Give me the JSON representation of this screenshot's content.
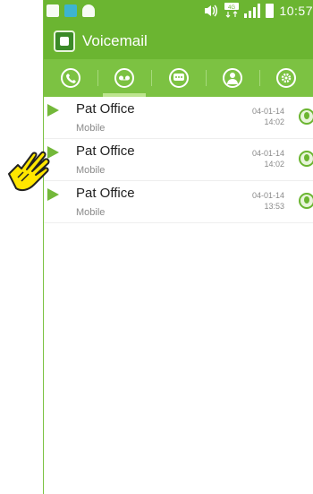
{
  "status_bar": {
    "time": "10:57",
    "network_label": "4G",
    "icons": [
      "gallery-icon",
      "app-icon",
      "chat-icon",
      "volume-icon",
      "network-icon",
      "signal-icon",
      "battery-icon"
    ]
  },
  "header": {
    "title": "Voicemail",
    "logo_icon": "voicemail-app-icon"
  },
  "tabs": [
    {
      "icon": "phone-icon",
      "active": false
    },
    {
      "icon": "voicemail-icon",
      "active": true
    },
    {
      "icon": "message-icon",
      "active": false
    },
    {
      "icon": "contact-icon",
      "active": false
    },
    {
      "icon": "settings-icon",
      "active": false
    }
  ],
  "voicemails": [
    {
      "name": "Pat Office",
      "type": "Mobile",
      "date": "04-01-14",
      "time": "14:02"
    },
    {
      "name": "Pat Office",
      "type": "Mobile",
      "date": "04-01-14",
      "time": "14:02"
    },
    {
      "name": "Pat Office",
      "type": "Mobile",
      "date": "04-01-14",
      "time": "13:53"
    }
  ],
  "colors": {
    "accent": "#6bb531",
    "tab_bar": "#7cc242",
    "pointer": "#ffe600"
  }
}
